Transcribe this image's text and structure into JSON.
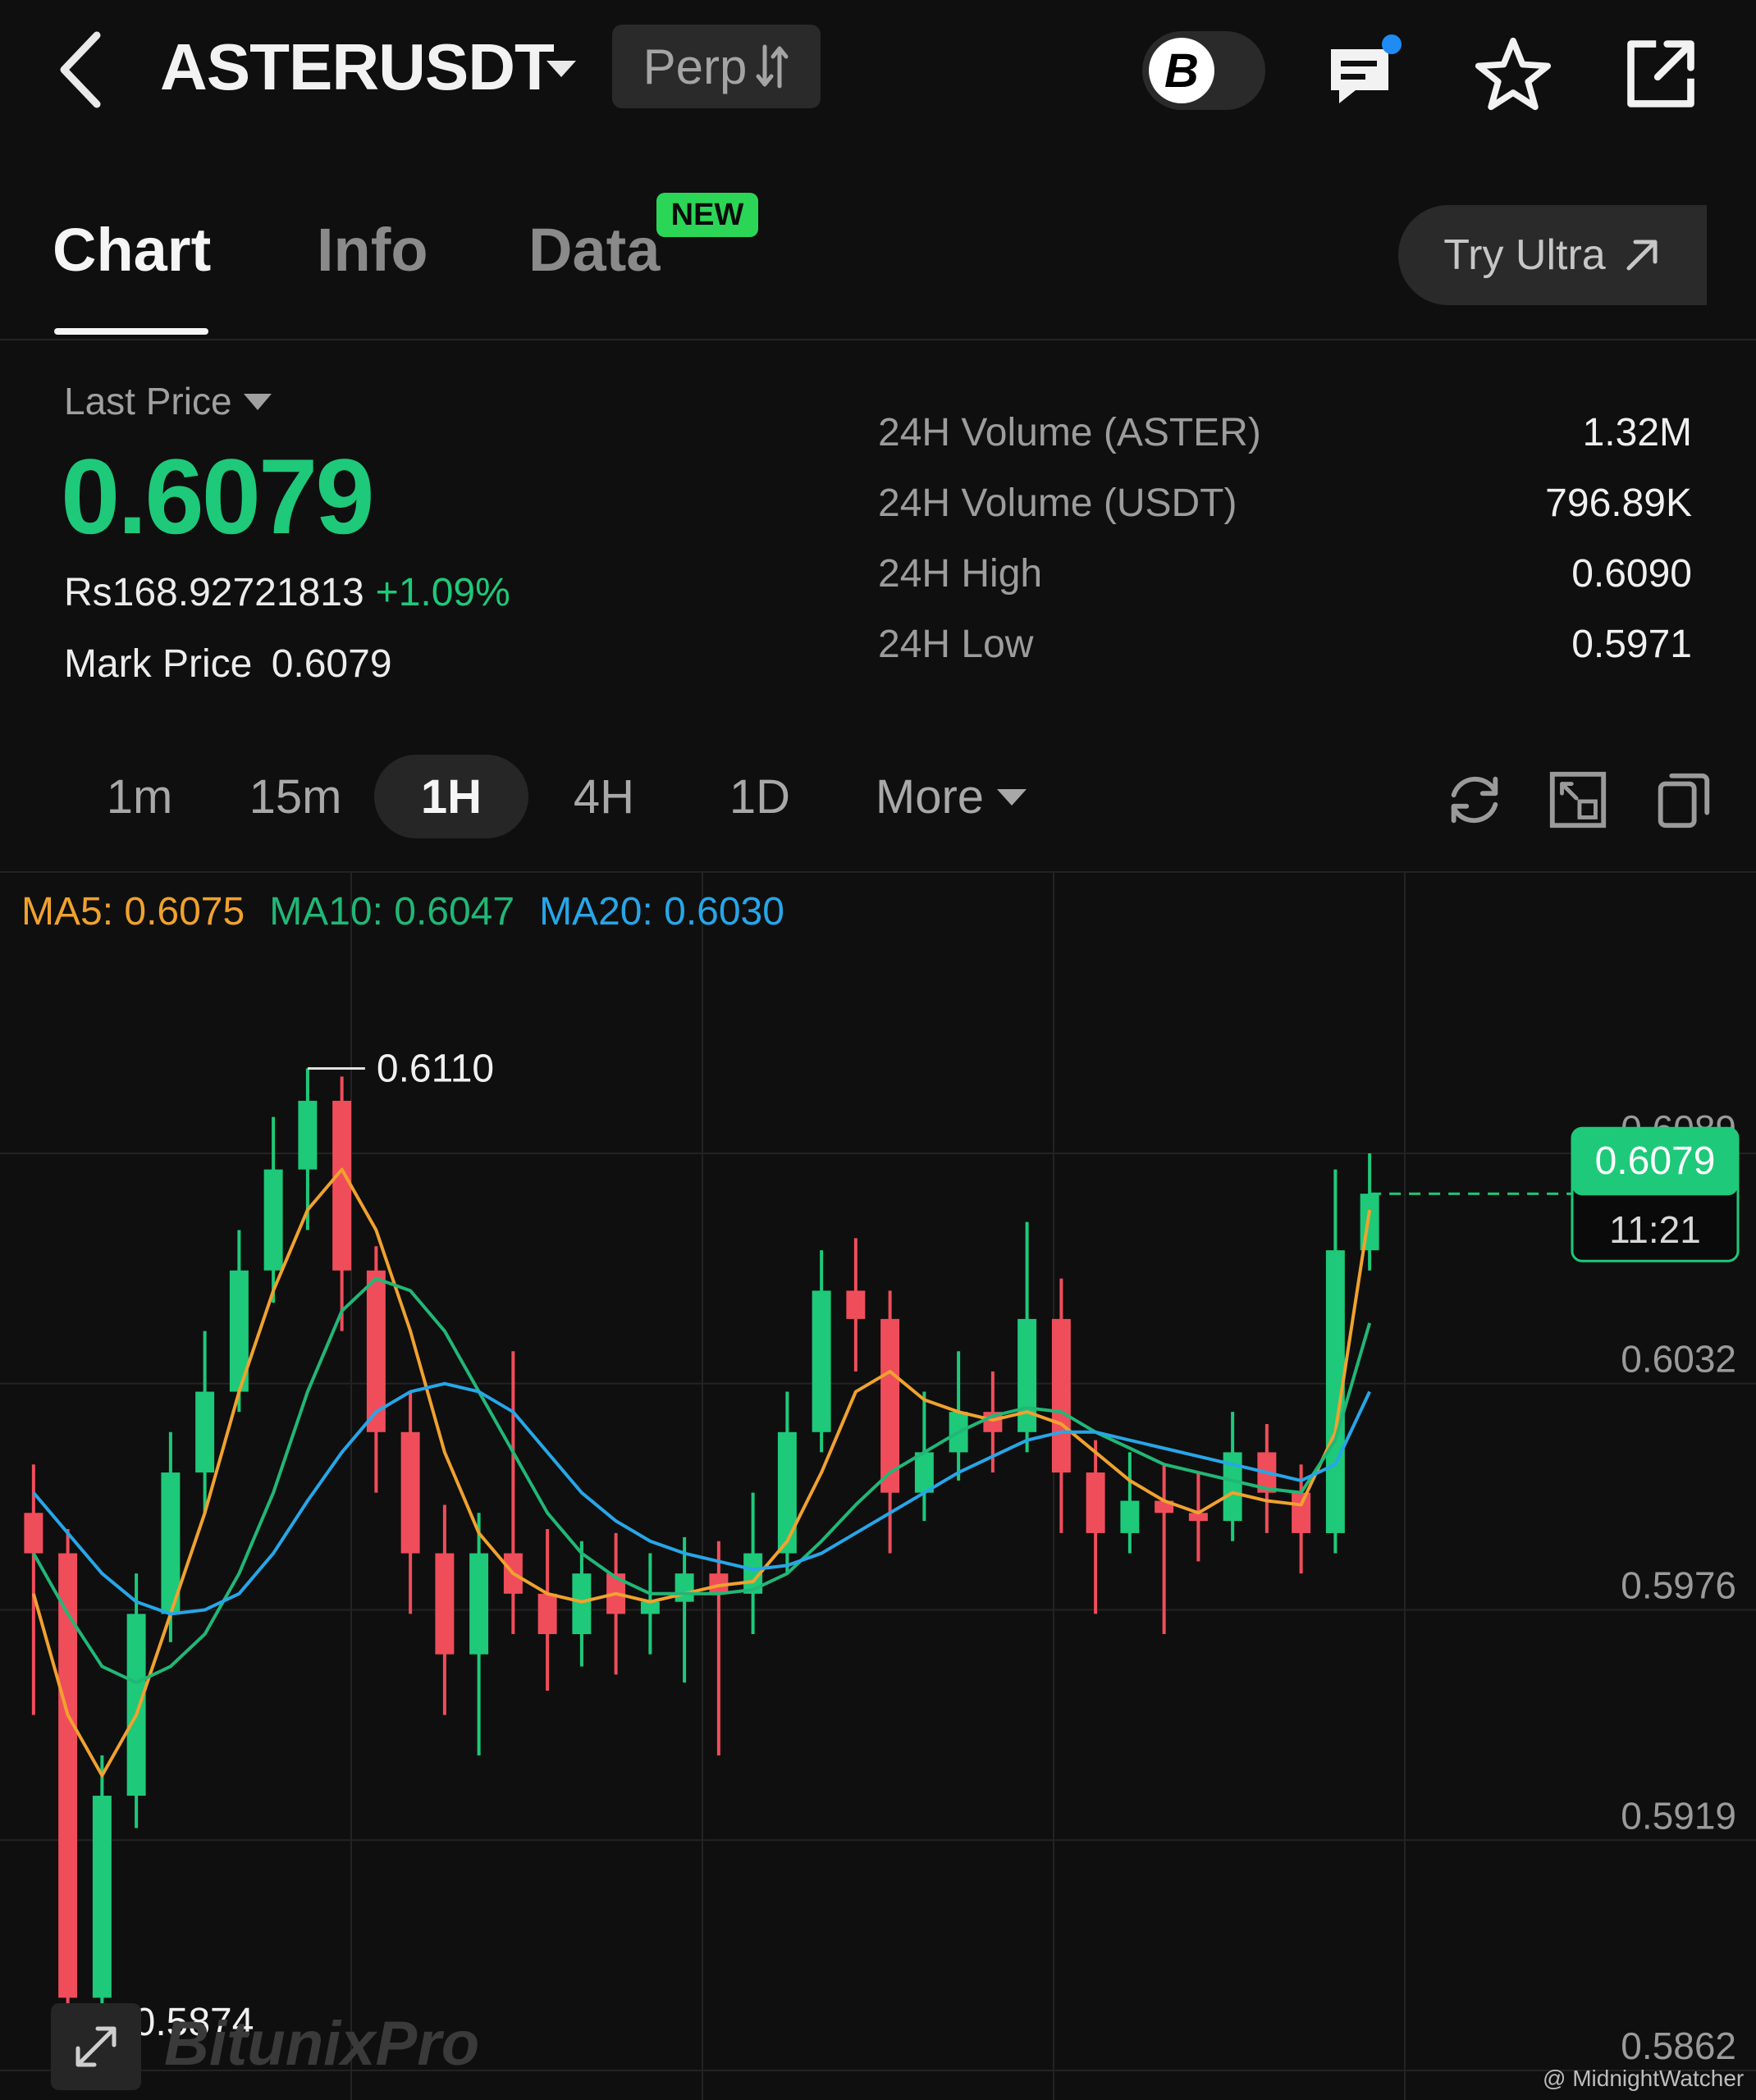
{
  "header": {
    "symbol": "ASTERUSDT",
    "contract_type": "Perp",
    "toggle_letter": "B"
  },
  "tabs": [
    {
      "label": "Chart",
      "active": true
    },
    {
      "label": "Info",
      "active": false
    },
    {
      "label": "Data",
      "active": false,
      "badge": "NEW"
    }
  ],
  "try_ultra": "Try Ultra",
  "price": {
    "last_price_label": "Last Price",
    "last_price": "0.6079",
    "fiat_value": "Rs168.92721813",
    "change": "+1.09%",
    "mark_price_label": "Mark Price",
    "mark_price": "0.6079"
  },
  "stats": [
    {
      "label": "24H Volume (ASTER)",
      "value": "1.32M"
    },
    {
      "label": "24H Volume (USDT)",
      "value": "796.89K"
    },
    {
      "label": "24H High",
      "value": "0.6090"
    },
    {
      "label": "24H Low",
      "value": "0.5971"
    }
  ],
  "intervals": [
    {
      "label": "1m",
      "active": false
    },
    {
      "label": "15m",
      "active": false
    },
    {
      "label": "1H",
      "active": true
    },
    {
      "label": "4H",
      "active": false
    },
    {
      "label": "1D",
      "active": false
    },
    {
      "label": "More",
      "active": false
    }
  ],
  "ma_legend": {
    "ma5": "MA5: 0.6075",
    "ma10": "MA10: 0.6047",
    "ma20": "MA20: 0.6030"
  },
  "colors": {
    "up": "#1ec97a",
    "down": "#f04d5a",
    "ma5": "#f0a22e",
    "ma10": "#21b777",
    "ma20": "#27a6e8",
    "background": "#0f0f0f"
  },
  "icons": [
    "back-icon",
    "caret-down-icon",
    "swap-icon",
    "chat-icon",
    "star-icon",
    "share-icon",
    "external-arrow-icon",
    "refresh-icon",
    "indicator-icon",
    "copy-icon",
    "expand-icon"
  ],
  "watermark": "BitunixPro",
  "credit": "@ MidnightWatcher",
  "chart_data": {
    "type": "candlestick",
    "ylim": [
      0.5862,
      0.613
    ],
    "y_ticks": [
      "0.6089",
      "0.6032",
      "0.5976",
      "0.5919",
      "0.5862"
    ],
    "annotations": {
      "high_label": "0.6110",
      "low_label": "0.5874"
    },
    "current_price_tag": "0.6079",
    "countdown": "11:21",
    "candles": [
      [
        0.6,
        0.599,
        0.6012,
        0.595
      ],
      [
        0.599,
        0.588,
        0.5996,
        0.5874
      ],
      [
        0.588,
        0.593,
        0.594,
        0.5878
      ],
      [
        0.593,
        0.5975,
        0.5985,
        0.5922
      ],
      [
        0.5975,
        0.601,
        0.602,
        0.5968
      ],
      [
        0.601,
        0.603,
        0.6045,
        0.6
      ],
      [
        0.603,
        0.606,
        0.607,
        0.6025
      ],
      [
        0.606,
        0.6085,
        0.6098,
        0.6052
      ],
      [
        0.6085,
        0.6102,
        0.611,
        0.607
      ],
      [
        0.6102,
        0.606,
        0.6108,
        0.6045
      ],
      [
        0.606,
        0.602,
        0.6066,
        0.6005
      ],
      [
        0.602,
        0.599,
        0.603,
        0.5975
      ],
      [
        0.599,
        0.5965,
        0.6002,
        0.595
      ],
      [
        0.5965,
        0.599,
        0.6,
        0.594
      ],
      [
        0.599,
        0.598,
        0.604,
        0.597
      ],
      [
        0.598,
        0.597,
        0.5996,
        0.5956
      ],
      [
        0.597,
        0.5985,
        0.5993,
        0.5962
      ],
      [
        0.5985,
        0.5975,
        0.5995,
        0.596
      ],
      [
        0.5975,
        0.5978,
        0.599,
        0.5965
      ],
      [
        0.5978,
        0.5985,
        0.5994,
        0.5958
      ],
      [
        0.5985,
        0.598,
        0.5993,
        0.594
      ],
      [
        0.598,
        0.599,
        0.6005,
        0.597
      ],
      [
        0.599,
        0.602,
        0.603,
        0.5985
      ],
      [
        0.602,
        0.6055,
        0.6065,
        0.6015
      ],
      [
        0.6055,
        0.6048,
        0.6068,
        0.6035
      ],
      [
        0.6048,
        0.6005,
        0.6055,
        0.599
      ],
      [
        0.6005,
        0.6015,
        0.603,
        0.5998
      ],
      [
        0.6015,
        0.6025,
        0.604,
        0.6008
      ],
      [
        0.6025,
        0.602,
        0.6035,
        0.601
      ],
      [
        0.602,
        0.6048,
        0.6072,
        0.6015
      ],
      [
        0.6048,
        0.601,
        0.6058,
        0.5995
      ],
      [
        0.601,
        0.5995,
        0.6018,
        0.5975
      ],
      [
        0.5995,
        0.6003,
        0.6015,
        0.599
      ],
      [
        0.6003,
        0.6,
        0.6012,
        0.597
      ],
      [
        0.6,
        0.5998,
        0.601,
        0.5988
      ],
      [
        0.5998,
        0.6015,
        0.6025,
        0.5993
      ],
      [
        0.6015,
        0.6005,
        0.6022,
        0.5995
      ],
      [
        0.6005,
        0.5995,
        0.6012,
        0.5985
      ],
      [
        0.5995,
        0.6065,
        0.6085,
        0.599
      ],
      [
        0.6065,
        0.6079,
        0.6089,
        0.606
      ]
    ],
    "ma_series": [
      {
        "name": "MA5",
        "values": [
          0.598,
          0.595,
          0.5935,
          0.595,
          0.5975,
          0.6,
          0.603,
          0.6055,
          0.6075,
          0.6085,
          0.607,
          0.6045,
          0.6015,
          0.5995,
          0.5985,
          0.598,
          0.5978,
          0.598,
          0.5978,
          0.598,
          0.5982,
          0.5983,
          0.5993,
          0.601,
          0.603,
          0.6035,
          0.6028,
          0.6025,
          0.6023,
          0.6025,
          0.6022,
          0.6015,
          0.6008,
          0.6003,
          0.6,
          0.6005,
          0.6003,
          0.6002,
          0.602,
          0.6075
        ]
      },
      {
        "name": "MA10",
        "values": [
          0.599,
          0.5975,
          0.5962,
          0.5958,
          0.5962,
          0.597,
          0.5985,
          0.6005,
          0.603,
          0.605,
          0.6058,
          0.6055,
          0.6045,
          0.603,
          0.6015,
          0.6,
          0.599,
          0.5984,
          0.598,
          0.598,
          0.598,
          0.5981,
          0.5985,
          0.5993,
          0.6002,
          0.601,
          0.6015,
          0.602,
          0.6024,
          0.6026,
          0.6025,
          0.602,
          0.6016,
          0.6012,
          0.601,
          0.6008,
          0.6006,
          0.6005,
          0.6018,
          0.6047
        ]
      },
      {
        "name": "MA20",
        "values": [
          0.6005,
          0.5995,
          0.5985,
          0.5978,
          0.5975,
          0.5976,
          0.598,
          0.599,
          0.6003,
          0.6015,
          0.6025,
          0.603,
          0.6032,
          0.603,
          0.6025,
          0.6015,
          0.6005,
          0.5998,
          0.5993,
          0.599,
          0.5988,
          0.5986,
          0.5987,
          0.599,
          0.5995,
          0.6,
          0.6005,
          0.601,
          0.6014,
          0.6018,
          0.602,
          0.602,
          0.6018,
          0.6016,
          0.6014,
          0.6012,
          0.601,
          0.6008,
          0.6012,
          0.603
        ]
      }
    ]
  }
}
